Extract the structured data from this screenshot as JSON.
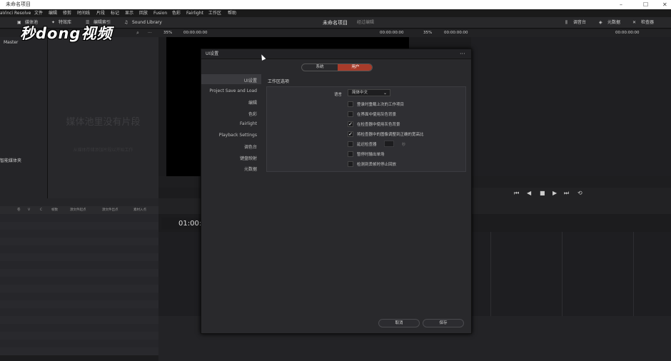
{
  "window": {
    "title": "未命名项目",
    "minimize": "–",
    "maximize": "☐",
    "close": "✕"
  },
  "menu": [
    "aVinci Resolve",
    "文件",
    "编辑",
    "修剪",
    "时间线",
    "片段",
    "标记",
    "显示",
    "回放",
    "Fusion",
    "色彩",
    "Fairlight",
    "工作区",
    "帮助"
  ],
  "toolbar": {
    "media_pool": "媒体池",
    "effects": "特效库",
    "edit_index": "编辑索引",
    "sound_library": "Sound Library",
    "project_name": "未命名项目",
    "edited": "经过编辑",
    "mixer": "调音台",
    "metadata": "元数据",
    "inspector": "检查器"
  },
  "watermark": "秒dong视频",
  "viewer_bar": {
    "zoom_left": "35%",
    "tc_left": "00:00:00:00",
    "tc_left_end": "00:00:00:00",
    "zoom_right": "35%",
    "tc_right": "00:00:00:00",
    "tc_right_end": "00:00:00:00",
    "more": "···"
  },
  "media_pool": {
    "master": "Master",
    "empty_title": "媒体池里没有片段",
    "empty_hint": "从媒体存储添加片段以开始工作",
    "smart_bins": "智能媒体夹"
  },
  "list_columns": [
    "卷",
    "V",
    "C",
    "帧数",
    "源文件起点",
    "源文件出点",
    "素材入点"
  ],
  "timeline": {
    "timecode": "01:00:"
  },
  "dialog": {
    "title": "UI设置",
    "tabs": {
      "system": "系统",
      "user": "用户"
    },
    "nav": [
      "UI设置",
      "Project Save and Load",
      "编辑",
      "色彩",
      "Fairlight",
      "Playback Settings",
      "调色台",
      "键盘映射",
      "元数据"
    ],
    "section_title": "工作区选项",
    "language_label": "语言",
    "language_value": "简体中文",
    "options": [
      {
        "label": "登录时重载上次的工作项目",
        "checked": false
      },
      {
        "label": "在界面中使用灰色背景",
        "checked": false
      },
      {
        "label": "在检查器中使用灰色背景",
        "checked": true
      },
      {
        "label": "将检查器中的图像调整到正确的宽高比",
        "checked": true
      },
      {
        "label": "延迟检查器",
        "checked": false
      },
      {
        "label": "暂停时输出单场",
        "checked": false
      },
      {
        "label": "检测到丢帧时停止回放",
        "checked": false
      }
    ],
    "delay_unit": "秒",
    "cancel": "取消",
    "save": "保存"
  }
}
